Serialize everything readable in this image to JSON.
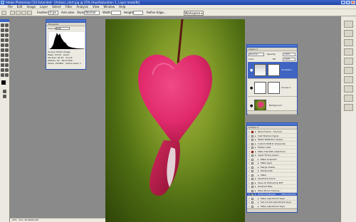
{
  "window": {
    "title": "Adobe Photoshop CS3 Extended - [Actions_start.jpg @ 25% (Hue/Saturation 1, Layer mask/8)]",
    "min": "_",
    "max": "□",
    "close": "×"
  },
  "menu": [
    "File",
    "Edit",
    "Image",
    "Layer",
    "Select",
    "Filter",
    "Analysis",
    "View",
    "Window",
    "Help"
  ],
  "options": {
    "feather_label": "Feather:",
    "feather_value": "0 px",
    "antialias_label": "Anti-alias",
    "style_label": "Style:",
    "style_value": "Normal",
    "width_label": "Width:",
    "height_label": "Height:",
    "refine_label": "Refine Edge...",
    "workspace": "Workspace ▾"
  },
  "histogram": {
    "tabs": "Histogram",
    "channel_label": "Channel:",
    "channel_value": "RGB",
    "stats": [
      [
        "Source:",
        "Entire Image"
      ],
      [
        "Mean:",
        "93.04",
        "Level:",
        ""
      ],
      [
        "Std Dev:",
        "44.43",
        "Count:",
        ""
      ],
      [
        "Median:",
        "92",
        "Percentile:",
        ""
      ],
      [
        "Pixels:",
        "167884",
        "Cache Level:",
        "1"
      ]
    ]
  },
  "layers": {
    "tabs": "Layers ×",
    "blend_mode": "Normal",
    "opacity_label": "Opacity:",
    "opacity_value": "100%",
    "lock_label": "Lock:",
    "fill_label": "Fill:",
    "fill_value": "100%",
    "rows": [
      {
        "name": "Hue/Satu...",
        "selected": true
      },
      {
        "name": "Curves 1",
        "selected": false
      },
      {
        "name": "Background",
        "selected": false
      }
    ]
  },
  "actions": {
    "tabs": "Actions ×",
    "rows": [
      {
        "label": "Wood Frame - 50 pixel",
        "indent": 0,
        "red": true,
        "keys": ""
      },
      {
        "label": "Cast Shadow (type)",
        "indent": 0,
        "red": false,
        "keys": ""
      },
      {
        "label": "Water Reflection (type)",
        "indent": 0,
        "red": false,
        "keys": ""
      },
      {
        "label": "Custom RGB to Grayscale",
        "indent": 0,
        "red": false,
        "keys": ""
      },
      {
        "label": "Molten Lead",
        "indent": 0,
        "red": false,
        "keys": ""
      },
      {
        "label": "Make Clip Path (selection)",
        "indent": 0,
        "red": true,
        "keys": ""
      },
      {
        "label": "Sepia Toning (layer)",
        "indent": 0,
        "red": false,
        "keys": ""
      },
      {
        "label": "Make snapshot",
        "indent": 1,
        "red": false,
        "keys": ""
      },
      {
        "label": "Make layer",
        "indent": 1,
        "red": false,
        "keys": ""
      },
      {
        "label": "Merge Visible",
        "indent": 1,
        "red": false,
        "keys": ""
      },
      {
        "label": "Desaturate",
        "indent": 1,
        "red": false,
        "keys": ""
      },
      {
        "label": "Make",
        "indent": 1,
        "red": false,
        "keys": ""
      },
      {
        "label": "Quadrant Colors",
        "indent": 0,
        "red": false,
        "keys": ""
      },
      {
        "label": "Save As Photoshop PDF",
        "indent": 0,
        "red": false,
        "keys": ""
      },
      {
        "label": "Gradient Map",
        "indent": 0,
        "red": false,
        "keys": ""
      },
      {
        "label": "Mixer Brush Cloning...",
        "indent": 0,
        "red": false,
        "keys": ""
      },
      {
        "label": "Actions Example",
        "indent": 0,
        "red": false,
        "keys": "Shft+Ctrl+F2",
        "selected": true
      },
      {
        "label": "Make adjustment layer",
        "indent": 1,
        "red": false,
        "keys": ""
      },
      {
        "label": "Set current adjustment layer",
        "indent": 1,
        "red": false,
        "keys": ""
      },
      {
        "label": "Make adjustment layer",
        "indent": 1,
        "red": false,
        "keys": ""
      },
      {
        "label": "Set current adjustment layer",
        "indent": 1,
        "red": false,
        "keys": ""
      }
    ]
  },
  "status": {
    "zoom": "25%",
    "doc": "Doc: 26.4M/53.0M"
  },
  "colors": {
    "title_blue": "#2f56b0",
    "selection_blue": "#3f64c2",
    "flower_pink": "#e23a78",
    "canvas_green": "#5a7a16"
  }
}
